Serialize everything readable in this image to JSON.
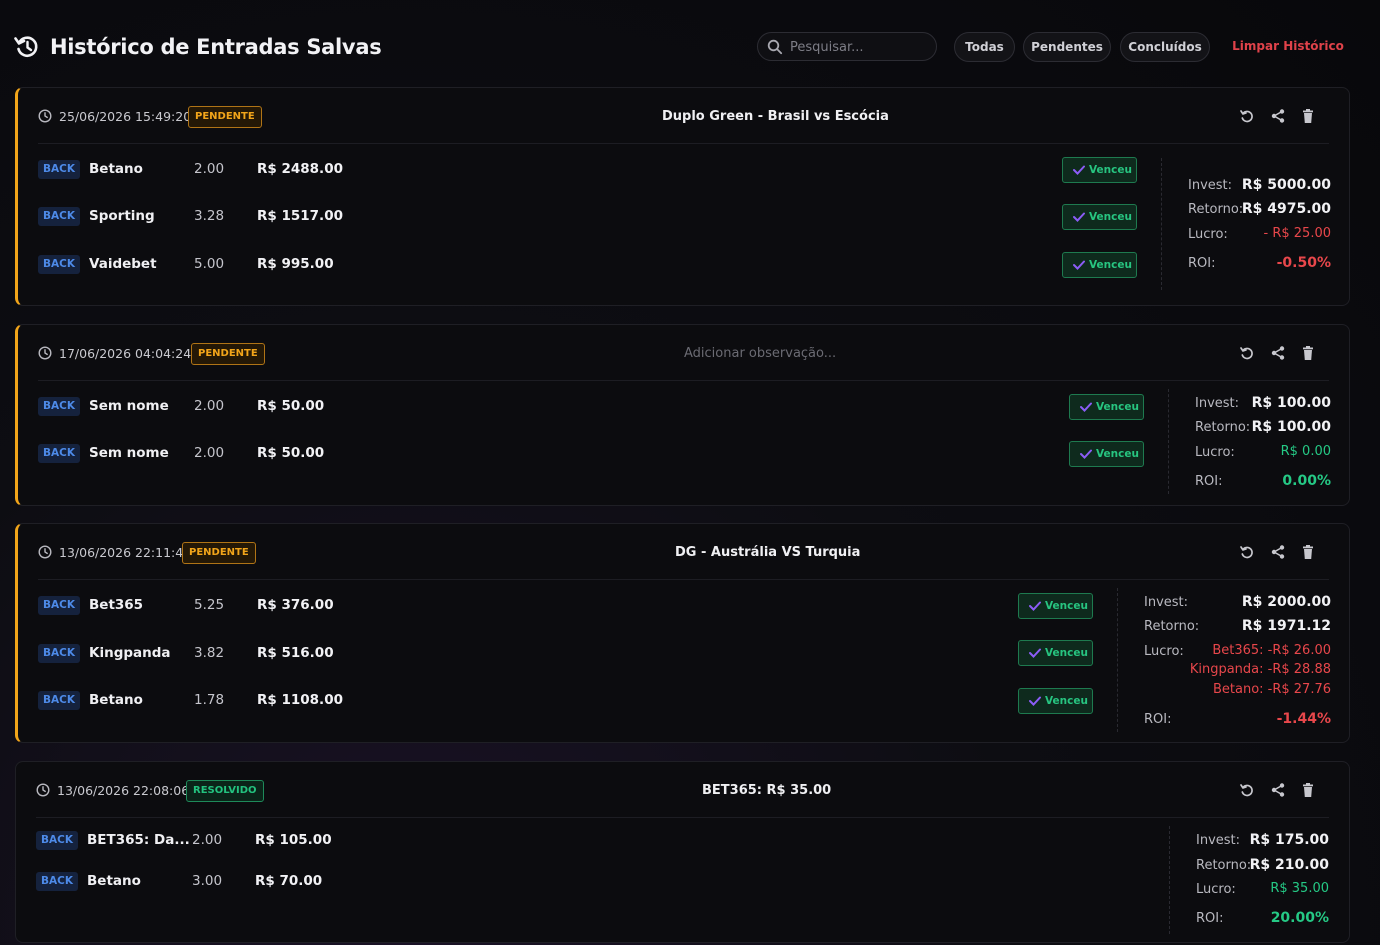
{
  "header": {
    "title": "Histórico de Entradas Salvas",
    "search_placeholder": "Pesquisar...",
    "filters": [
      "Todas",
      "Pendentes",
      "Concluídos"
    ],
    "clear_label": "Limpar Histórico"
  },
  "labels": {
    "back": "BACK",
    "won": "Venceu",
    "invest": "Invest:",
    "return": "Retorno:",
    "profit": "Lucro:",
    "roi": "ROI:"
  },
  "entries": [
    {
      "date": "25/06/2026 15:49:20",
      "status": "PENDENTE",
      "note": "Duplo Green - Brasil vs Escócia",
      "bets": [
        {
          "house": "Betano",
          "odd": "2.00",
          "stake": "R$ 2488.00"
        },
        {
          "house": "Sporting",
          "odd": "3.28",
          "stake": "R$ 1517.00"
        },
        {
          "house": "Vaidebet",
          "odd": "5.00",
          "stake": "R$ 995.00"
        }
      ],
      "invest": "R$ 5000.00",
      "return": "R$ 4975.00",
      "profit": "- R$ 25.00",
      "roi": "-0.50%"
    },
    {
      "date": "17/06/2026 04:04:24",
      "status": "PENDENTE",
      "note": "Adicionar observação...",
      "bets": [
        {
          "house": "Sem nome",
          "odd": "2.00",
          "stake": "R$ 50.00"
        },
        {
          "house": "Sem nome",
          "odd": "2.00",
          "stake": "R$ 50.00"
        }
      ],
      "invest": "R$ 100.00",
      "return": "R$ 100.00",
      "profit": "R$ 0.00",
      "roi": "0.00%"
    },
    {
      "date": "13/06/2026 22:11:48",
      "status": "PENDENTE",
      "note": "DG - Austrália VS Turquia",
      "bets": [
        {
          "house": "Bet365",
          "odd": "5.25",
          "stake": "R$ 376.00"
        },
        {
          "house": "Kingpanda",
          "odd": "3.82",
          "stake": "R$ 516.00"
        },
        {
          "house": "Betano",
          "odd": "1.78",
          "stake": "R$ 1108.00"
        }
      ],
      "invest": "R$ 2000.00",
      "return": "R$ 1971.12",
      "profit_lines": [
        "Bet365: -R$ 26.00",
        "Kingpanda: -R$ 28.88",
        "Betano: -R$ 27.76"
      ],
      "roi": "-1.44%"
    },
    {
      "date": "13/06/2026 22:08:06",
      "status": "RESOLVIDO",
      "note": "BET365: R$ 35.00",
      "bets": [
        {
          "house": "BET365: Da...",
          "odd": "2.00",
          "stake": "R$ 105.00"
        },
        {
          "house": "Betano",
          "odd": "3.00",
          "stake": "R$ 70.00"
        }
      ],
      "invest": "R$ 175.00",
      "return": "R$ 210.00",
      "profit": "R$ 35.00",
      "roi": "20.00%"
    }
  ]
}
